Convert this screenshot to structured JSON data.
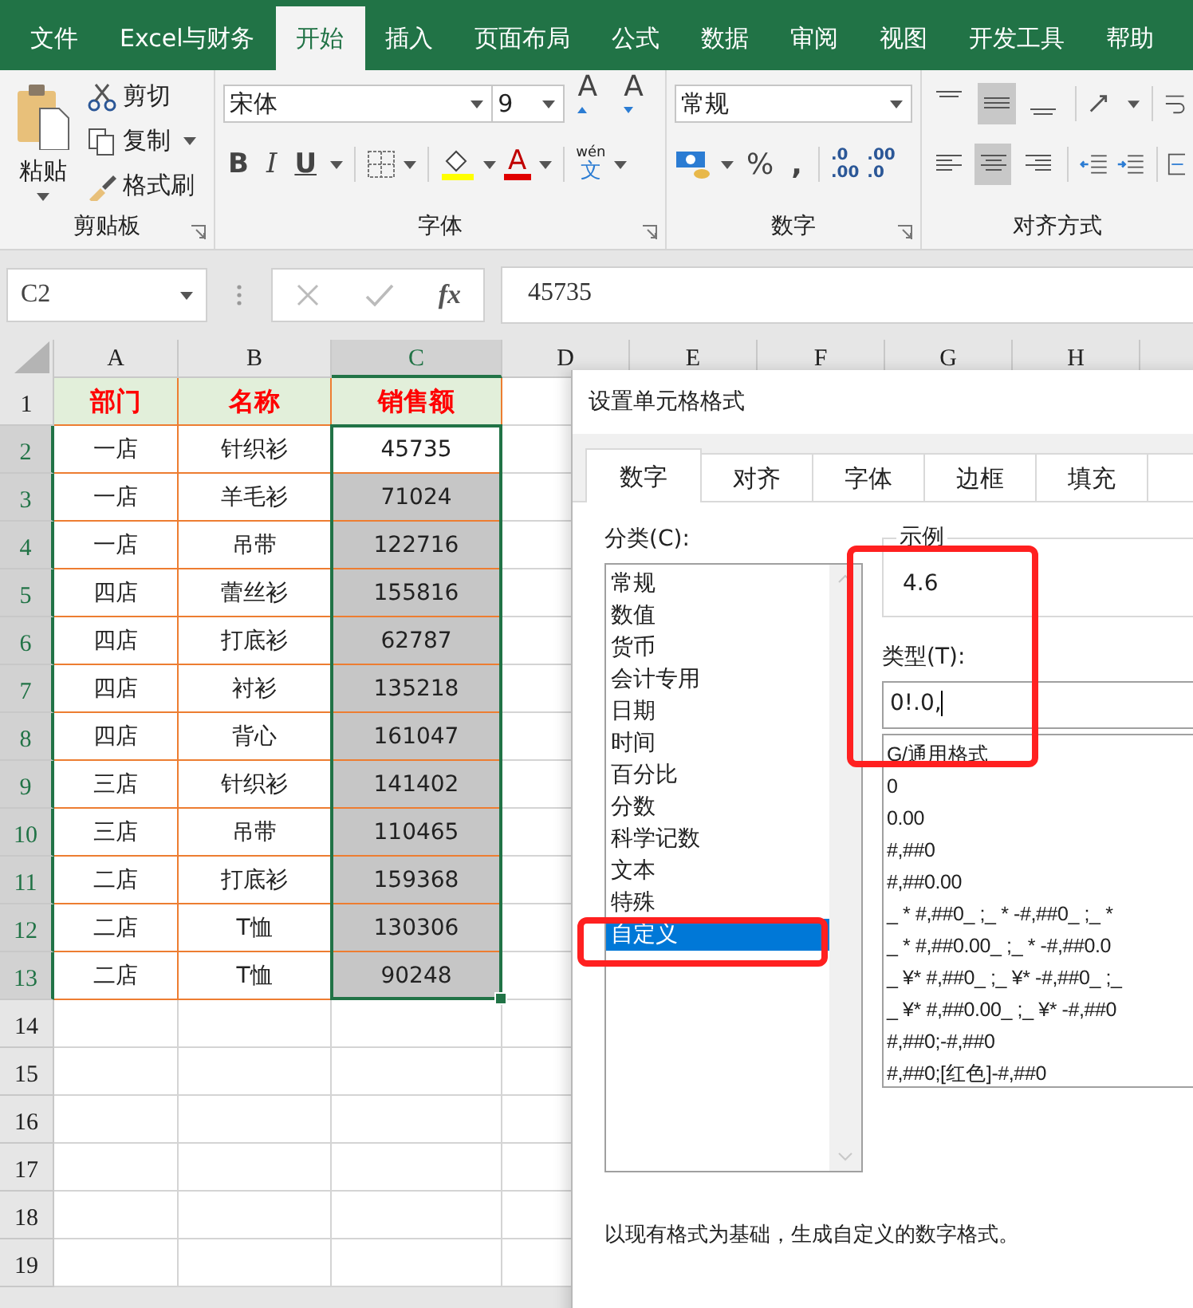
{
  "ribbon_tabs": [
    {
      "label": "文件",
      "selected": false
    },
    {
      "label": "Excel与财务",
      "selected": false
    },
    {
      "label": "开始",
      "selected": true
    },
    {
      "label": "插入",
      "selected": false
    },
    {
      "label": "页面布局",
      "selected": false
    },
    {
      "label": "公式",
      "selected": false
    },
    {
      "label": "数据",
      "selected": false
    },
    {
      "label": "审阅",
      "selected": false
    },
    {
      "label": "视图",
      "selected": false
    },
    {
      "label": "开发工具",
      "selected": false
    },
    {
      "label": "帮助",
      "selected": false
    }
  ],
  "clipboard": {
    "paste": "粘贴",
    "cut": "剪切",
    "copy": "复制",
    "format_painter": "格式刷",
    "group": "剪贴板"
  },
  "font": {
    "name": "宋体",
    "size": "9",
    "grow": "A",
    "shrink": "A",
    "bold": "B",
    "italic": "I",
    "underline": "U",
    "font_color": "A",
    "phonetic_top": "wén",
    "phonetic_bottom": "文",
    "group": "字体"
  },
  "number": {
    "format": "常规",
    "percent": "%",
    "comma": ",",
    "increase_decimal": [
      ".0",
      ".00"
    ],
    "decrease_decimal": [
      ".00",
      ".0"
    ],
    "group": "数字"
  },
  "alignment": {
    "vertical": [
      {
        "kind": "top",
        "selected": false
      },
      {
        "kind": "middle",
        "selected": true
      },
      {
        "kind": "bottom",
        "selected": false
      }
    ],
    "horizontal": [
      {
        "kind": "left",
        "selected": false
      },
      {
        "kind": "center",
        "selected": true
      },
      {
        "kind": "right",
        "selected": false
      }
    ],
    "group": "对齐方式"
  },
  "formula_bar": {
    "name_box": "C2",
    "fx": "fx",
    "value": "45735"
  },
  "sheet": {
    "columns": [
      {
        "label": "A",
        "selected": false
      },
      {
        "label": "B",
        "selected": false
      },
      {
        "label": "C",
        "selected": true
      },
      {
        "label": "D",
        "selected": false
      },
      {
        "label": "E",
        "selected": false
      },
      {
        "label": "F",
        "selected": false
      },
      {
        "label": "G",
        "selected": false
      },
      {
        "label": "H",
        "selected": false
      }
    ],
    "row_headers": [
      {
        "label": "1",
        "selected": false
      },
      {
        "label": "2",
        "selected": true
      },
      {
        "label": "3",
        "selected": true
      },
      {
        "label": "4",
        "selected": true
      },
      {
        "label": "5",
        "selected": true
      },
      {
        "label": "6",
        "selected": true
      },
      {
        "label": "7",
        "selected": true
      },
      {
        "label": "8",
        "selected": true
      },
      {
        "label": "9",
        "selected": true
      },
      {
        "label": "10",
        "selected": true
      },
      {
        "label": "11",
        "selected": true
      },
      {
        "label": "12",
        "selected": true
      },
      {
        "label": "13",
        "selected": true
      },
      {
        "label": "14",
        "selected": false
      },
      {
        "label": "15",
        "selected": false
      },
      {
        "label": "16",
        "selected": false
      },
      {
        "label": "17",
        "selected": false
      },
      {
        "label": "18",
        "selected": false
      },
      {
        "label": "19",
        "selected": false
      }
    ],
    "header": [
      "部门",
      "名称",
      "销售额"
    ],
    "rows": [
      {
        "cells": [
          "一店",
          "针织衫",
          "45735"
        ],
        "active": true
      },
      {
        "cells": [
          "一店",
          "羊毛衫",
          "71024"
        ],
        "active": false
      },
      {
        "cells": [
          "一店",
          "吊带",
          "122716"
        ],
        "active": false
      },
      {
        "cells": [
          "四店",
          "蕾丝衫",
          "155816"
        ],
        "active": false
      },
      {
        "cells": [
          "四店",
          "打底衫",
          "62787"
        ],
        "active": false
      },
      {
        "cells": [
          "四店",
          "衬衫",
          "135218"
        ],
        "active": false
      },
      {
        "cells": [
          "四店",
          "背心",
          "161047"
        ],
        "active": false
      },
      {
        "cells": [
          "三店",
          "针织衫",
          "141402"
        ],
        "active": false
      },
      {
        "cells": [
          "三店",
          "吊带",
          "110465"
        ],
        "active": false
      },
      {
        "cells": [
          "二店",
          "打底衫",
          "159368"
        ],
        "active": false
      },
      {
        "cells": [
          "二店",
          "T恤",
          "130306"
        ],
        "active": false
      },
      {
        "cells": [
          "二店",
          "T恤",
          "90248"
        ],
        "active": false
      }
    ]
  },
  "dialog": {
    "title": "设置单元格格式",
    "tabs": [
      {
        "label": "数字",
        "selected": true
      },
      {
        "label": "对齐",
        "selected": false
      },
      {
        "label": "字体",
        "selected": false
      },
      {
        "label": "边框",
        "selected": false
      },
      {
        "label": "填充",
        "selected": false
      }
    ],
    "category_label": "分类(C):",
    "categories": [
      {
        "label": "常规",
        "selected": false
      },
      {
        "label": "数值",
        "selected": false
      },
      {
        "label": "货币",
        "selected": false
      },
      {
        "label": "会计专用",
        "selected": false
      },
      {
        "label": "日期",
        "selected": false
      },
      {
        "label": "时间",
        "selected": false
      },
      {
        "label": "百分比",
        "selected": false
      },
      {
        "label": "分数",
        "selected": false
      },
      {
        "label": "科学记数",
        "selected": false
      },
      {
        "label": "文本",
        "selected": false
      },
      {
        "label": "特殊",
        "selected": false
      },
      {
        "label": "自定义",
        "selected": true
      }
    ],
    "sample_label": "示例",
    "sample_value": "4.6",
    "type_label": "类型(T):",
    "type_value": "0!.0,",
    "formats": [
      "G/通用格式",
      "0",
      "0.00",
      "#,##0",
      "#,##0.00",
      "_ * #,##0_ ;_ * -#,##0_ ;_ *",
      "_ * #,##0.00_ ;_ * -#,##0.0",
      "_ ¥* #,##0_ ;_ ¥* -#,##0_ ;_",
      "_ ¥* #,##0.00_ ;_ ¥* -#,##0",
      "#,##0;-#,##0",
      "#,##0;[红色]-#,##0"
    ],
    "description": "以现有格式为基础，生成自定义的数字格式。"
  }
}
